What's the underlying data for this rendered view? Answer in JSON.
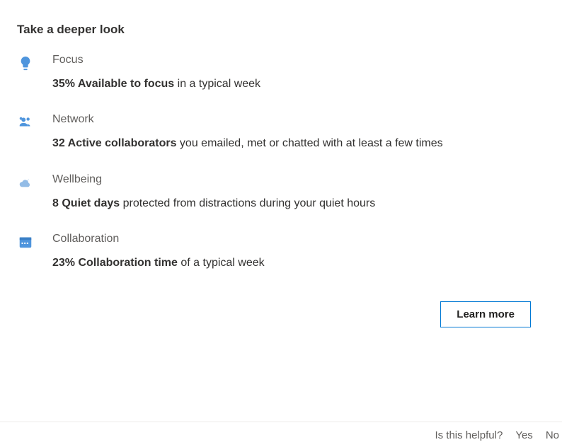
{
  "title": "Take a deeper look",
  "items": [
    {
      "icon": "lightbulb-icon",
      "label": "Focus",
      "bold": "35% Available to focus",
      "rest": " in a typical week"
    },
    {
      "icon": "people-icon",
      "label": "Network",
      "bold": "32 Active collaborators",
      "rest": " you emailed, met or chatted with at least a few times"
    },
    {
      "icon": "cloud-moon-icon",
      "label": "Wellbeing",
      "bold": "8 Quiet days",
      "rest": " protected from distractions during your quiet hours"
    },
    {
      "icon": "calendar-icon",
      "label": "Collaboration",
      "bold": "23% Collaboration time",
      "rest": " of a typical week"
    }
  ],
  "learn_more_label": "Learn more",
  "footer": {
    "prompt": "Is this helpful?",
    "yes": "Yes",
    "no": "No"
  },
  "colors": {
    "accent": "#4f95dd"
  }
}
